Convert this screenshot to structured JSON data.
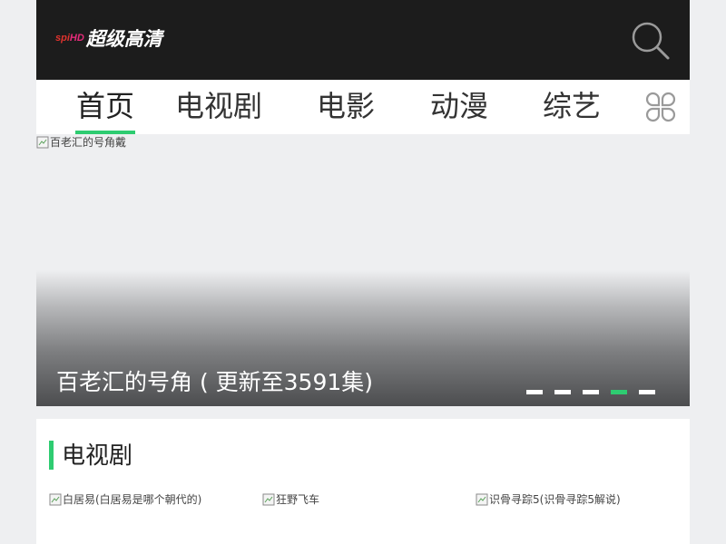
{
  "header": {
    "logo_spi": "spi",
    "logo_hd": "HD",
    "logo_text": "超级高清"
  },
  "icons": {
    "search": "search-icon",
    "more": "clover-icon",
    "broken_image": "broken-image-icon"
  },
  "nav": {
    "items": [
      {
        "label": "首页",
        "active": true
      },
      {
        "label": "电视剧",
        "active": false
      },
      {
        "label": "电影",
        "active": false
      },
      {
        "label": "动漫",
        "active": false
      },
      {
        "label": "综艺",
        "active": false
      }
    ]
  },
  "banner": {
    "image_alt": "百老汇的号角戴",
    "caption": "百老汇的号角 ( 更新至3591集)",
    "slide_count": 5,
    "active_slide": 4
  },
  "tv_section": {
    "title": "电视剧",
    "cards": [
      {
        "alt": "白居易(白居易是哪个朝代的)"
      },
      {
        "alt": "狂野飞车"
      },
      {
        "alt": "识骨寻踪5(识骨寻踪5解说)"
      }
    ]
  },
  "colors": {
    "accent": "#2ecc71",
    "header_bg": "#1c1c1c",
    "page_bg": "#eeeff1",
    "logo_spi": "#e0332e",
    "logo_hd": "#e52b7a"
  }
}
